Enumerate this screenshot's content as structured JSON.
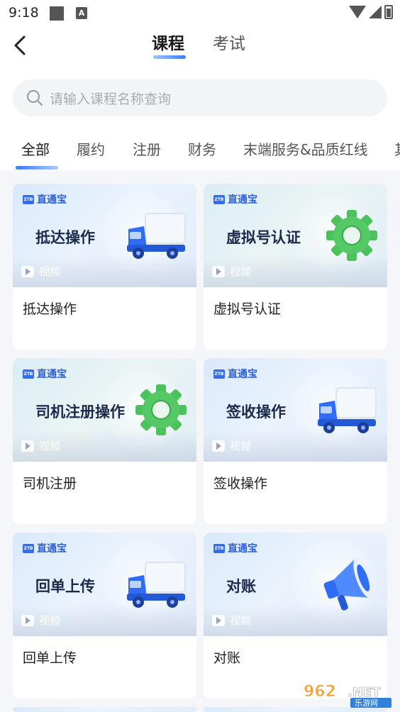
{
  "status_bar": {
    "time": "9:18",
    "notif_letter": "A"
  },
  "nav": {
    "tabs": [
      {
        "label": "课程",
        "active": true
      },
      {
        "label": "考试",
        "active": false
      }
    ]
  },
  "search": {
    "placeholder": "请输入课程名称查询"
  },
  "filters": [
    "全部",
    "履约",
    "注册",
    "财务",
    "末端服务&品质红线",
    "其"
  ],
  "cards": [
    {
      "brand": "直通宝",
      "thumb_title": "抵达操作",
      "tag": "视频",
      "title": "抵达操作",
      "icon": "truck-icon"
    },
    {
      "brand": "直通宝",
      "thumb_title": "虚拟号认证",
      "tag": "视频",
      "title": "虚拟号认证",
      "icon": "gear-icon"
    },
    {
      "brand": "直通宝",
      "thumb_title": "司机注册操作",
      "tag": "视频",
      "title": "司机注册",
      "icon": "gear-icon"
    },
    {
      "brand": "直通宝",
      "thumb_title": "签收操作",
      "tag": "视频",
      "title": "签收操作",
      "icon": "truck-icon"
    },
    {
      "brand": "直通宝",
      "thumb_title": "回单上传",
      "tag": "视频",
      "title": "回单上传",
      "icon": "truck-icon"
    },
    {
      "brand": "直通宝",
      "thumb_title": "对账",
      "tag": "视频",
      "title": "对账",
      "icon": "megaphone-icon"
    }
  ],
  "watermark": {
    "text": "962.NET",
    "sub": "乐游网"
  },
  "colors": {
    "accent": "#3d7bff",
    "brand_text": "#2d5fd9"
  }
}
